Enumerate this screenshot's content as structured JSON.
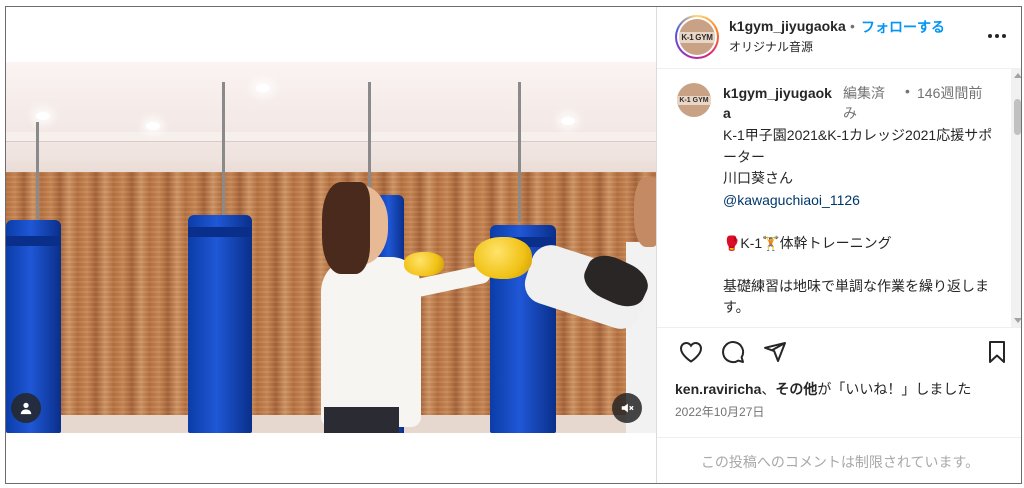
{
  "post": {
    "username": "k1gym_jiyugaoka",
    "separator": "•",
    "follow_label": "フォローする",
    "audio_label": "オリジナル音源",
    "avatar_logo": "K-1 GYM",
    "more_icon": "more-horizontal-icon"
  },
  "caption": {
    "username": "k1gym_jiyugaoka",
    "edited_label": "編集済み",
    "separator": "•",
    "time_label": "146週間前",
    "lines": [
      "K-1甲子園2021&K-1カレッジ2021応援サポーター",
      "川口葵さん"
    ],
    "mention": "@kawaguchiaoi_1126",
    "training_line": "🥊K-1🏋体幹トレーニング",
    "body": "基礎練習は地味で単調な作業を繰り返します。"
  },
  "actions": {
    "like_icon": "heart-icon",
    "comment_icon": "comment-icon",
    "share_icon": "send-icon",
    "save_icon": "bookmark-icon"
  },
  "likes": {
    "user": "ken.raviricha",
    "middle": "、",
    "others": "その他",
    "suffix": "が「いいね！」しました"
  },
  "date": "2022年10月27日",
  "comments_disabled": "この投稿へのコメントは制限されています。",
  "media": {
    "user_icon": "person-icon",
    "mute_icon": "speaker-muted-icon"
  },
  "colors": {
    "accent": "#0095f6",
    "bag_blue": "#1f57d6",
    "muted_text": "#737373"
  }
}
